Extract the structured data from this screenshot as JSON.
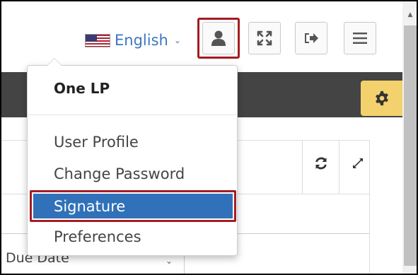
{
  "header": {
    "language": "English",
    "language_chevron": "⌄",
    "icons": {
      "flag": "us-flag-icon",
      "user": "user-icon",
      "fullscreen": "fullscreen-icon",
      "signout": "sign-out-icon",
      "menu": "hamburger-menu-icon"
    }
  },
  "toolbar": {
    "settings_icon": "gear-icon"
  },
  "panel": {
    "refresh_icon": "refresh-icon",
    "maximize_icon": "expand-icon",
    "column_label": "Due Date",
    "sort_indicator": "⌄"
  },
  "user_menu": {
    "header": "One LP",
    "items": [
      {
        "label": "User Profile"
      },
      {
        "label": "Change Password"
      },
      {
        "label": "Signature",
        "active": true
      },
      {
        "label": "Preferences"
      }
    ]
  },
  "colors": {
    "accent_blue": "#3071b9",
    "highlight_border": "#a31c22",
    "dark_band": "#444444",
    "gear_button": "#f3d26d",
    "link": "#3c76c0"
  }
}
